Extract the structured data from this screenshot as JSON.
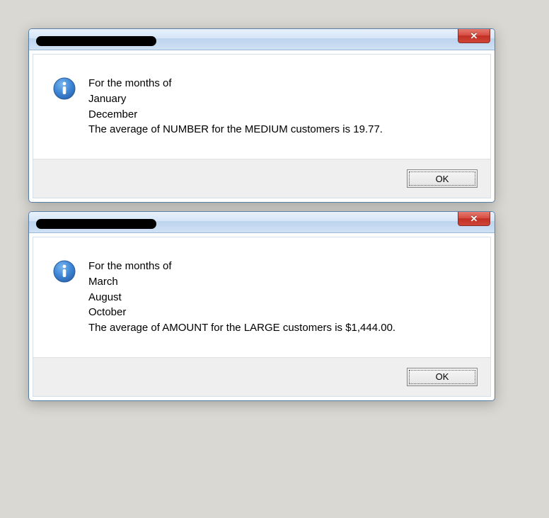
{
  "dialogs": [
    {
      "close": "✕",
      "message": "For the months of\nJanuary\nDecember\nThe average of NUMBER for the MEDIUM customers is 19.77.",
      "ok": "OK"
    },
    {
      "close": "✕",
      "message": "For the months of\nMarch\nAugust\nOctober\nThe average of AMOUNT for the LARGE customers is $1,444.00.",
      "ok": "OK"
    }
  ]
}
